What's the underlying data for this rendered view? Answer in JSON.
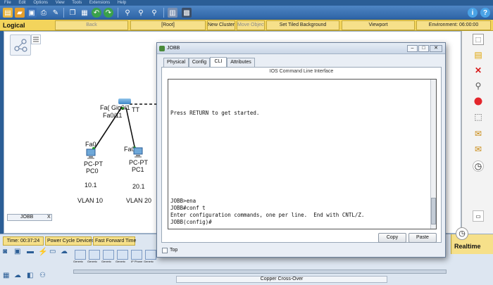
{
  "menubar": {
    "items": [
      "File",
      "Edit",
      "Options",
      "View",
      "Tools",
      "Extensions",
      "Help"
    ]
  },
  "toolbar": {
    "icons": [
      "new-icon",
      "open-icon",
      "save-icon",
      "print-icon",
      "activity-wizard-icon",
      "copy-icon",
      "paste-icon",
      "undo-icon",
      "redo-icon",
      "zoom-in-icon",
      "zoom-reset-icon",
      "zoom-out-icon",
      "palette-icon",
      "custom-device-icon",
      "info-icon",
      "help-icon"
    ]
  },
  "logicalbar": {
    "mode": "Logical",
    "back": "Back",
    "root": "[Root]",
    "new_cluster": "New Cluster",
    "move_object": "Move Object",
    "tiled_bg": "Set Tiled Background",
    "viewport": "Viewport",
    "environment": "Environment: 06:00:00"
  },
  "workspace": {
    "switch_port_label": "Fa( Gig0/1",
    "switch_tt": "TT",
    "switch_port2": "Fa0/11",
    "pc0": {
      "port": "Fa0",
      "type": "PC-PT",
      "name": "PC0",
      "ip": "10.1",
      "vlan": "VLAN 10"
    },
    "pc1": {
      "port": "Fa0",
      "type": "PC-PT",
      "name": "PC1",
      "ip": "20.1",
      "vlan": "VLAN 20"
    },
    "tab_label": "JOBB",
    "tab_close": "X"
  },
  "dialog": {
    "title": "JOBB",
    "tabs": [
      "Physical",
      "Config",
      "CLI",
      "Attributes"
    ],
    "active_tab": "CLI",
    "heading": "IOS Command Line Interface",
    "terminal_lines": [
      "Press RETURN to get started.",
      "JOBB>ena",
      "JOBB#conf t",
      "Enter configuration commands, one per line.  End with CNTL/Z.",
      "JOBB(config)#"
    ],
    "copy_label": "Copy",
    "paste_label": "Paste",
    "top_label": "Top"
  },
  "bottom": {
    "time": "Time: 00:37:24",
    "power_cycle": "Power Cycle Devices",
    "fast_forward": "Fast Forward Time",
    "realtime": "Realtime",
    "cable_label": "Copper Cross-Over",
    "device_labels": [
      "Generic",
      "Generic",
      "Generic",
      "Generic",
      "IP Phone",
      "Generic"
    ]
  },
  "colors": {
    "toolbar_blue": "#2e64a6",
    "logical_yellow": "#f3d45c",
    "link_green": "#1fa01f"
  }
}
